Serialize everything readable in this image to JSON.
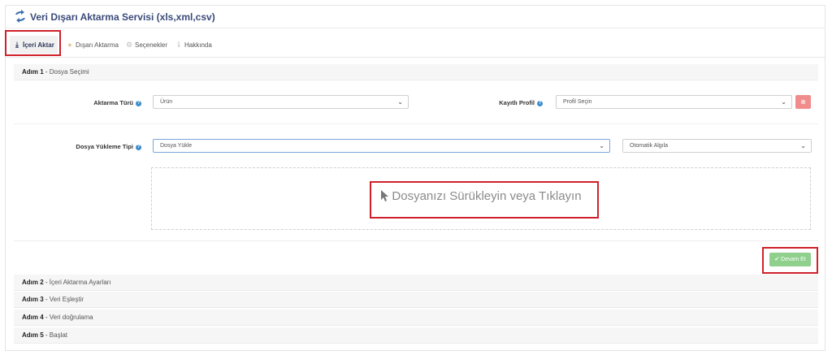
{
  "header": {
    "title": "Veri Dışarı Aktarma Servisi (xls,xml,csv)",
    "icon": "sync-arrows-icon"
  },
  "tabs": [
    {
      "label": "İçeri Aktar",
      "icon": "download-icon",
      "active": true
    },
    {
      "label": "Dışarı Aktarma",
      "icon": "upload-user-icon"
    },
    {
      "label": "Seçenekler",
      "icon": "gear-icon"
    },
    {
      "label": "Hakkında",
      "icon": "info-icon"
    }
  ],
  "steps": [
    {
      "num": "Adım 1",
      "title": "Dosya Seçimi"
    },
    {
      "num": "Adım 2",
      "title": "İçeri Aktarma Ayarları"
    },
    {
      "num": "Adım 3",
      "title": "Veri Eşleştir"
    },
    {
      "num": "Adım 4",
      "title": "Veri doğrulama"
    },
    {
      "num": "Adım 5",
      "title": "Başlat"
    }
  ],
  "form": {
    "aktarma_turu_label": "Aktarma Türü",
    "aktarma_turu_value": "Ürün",
    "kayitli_profil_label": "Kayıtlı Profil",
    "kayitli_profil_value": "Profil Seçin",
    "dosya_yukleme_label": "Dosya Yükleme Tipi",
    "dosya_yukleme_value": "Dosya Yükle",
    "detection_value": "Otomatik Algıla"
  },
  "dropzone": {
    "text": "Dosyanızı Sürükleyin veya Tıklayın"
  },
  "buttons": {
    "continue": "Devam Et"
  },
  "colors": {
    "accent": "#3c8dcb",
    "highlight": "#d0212b",
    "success": "#8fd08c",
    "danger": "#f08c8c"
  }
}
